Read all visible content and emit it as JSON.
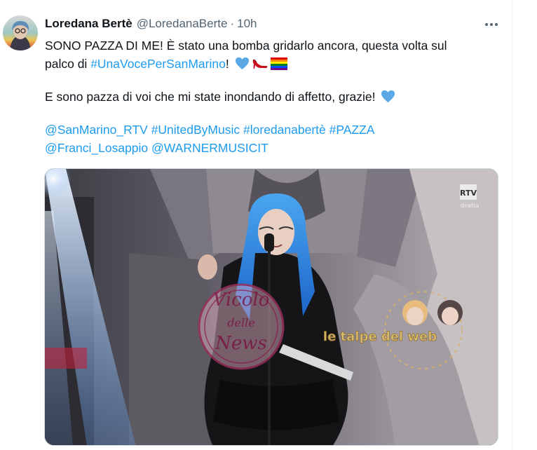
{
  "tweet": {
    "author_name": "Loredana Bertè",
    "handle": "@LoredanaBerte",
    "separator": "·",
    "time": "10h",
    "line1": "SONO PAZZA DI ME! È stato una bomba gridarlo ancora, questa volta sul",
    "line2_prefix": "palco di ",
    "line2_hashtag": "#UnaVocePerSanMarino",
    "line2_suffix": "!",
    "line3": "E sono pazza di voi che mi state inondando di affetto, grazie!",
    "mentions_line1": [
      "@SanMarino_RTV",
      "#UnitedByMusic",
      "#loredanabertè",
      "#PAZZA"
    ],
    "mentions_line2": [
      "@Franci_Losappio",
      "@WARNERMUSICIT"
    ]
  },
  "media": {
    "broadcaster_badge": "diretta",
    "watermark_1_lines": [
      "Vicolo",
      "delle",
      "News"
    ],
    "watermark_2": "le talpe del web"
  },
  "icons": {
    "more": "more-horizontal-icon",
    "heart": "blue-heart-icon",
    "heel": "high-heel-icon",
    "flag": "rainbow-flag-icon"
  },
  "colors": {
    "link": "#1d9bf0",
    "secondary_text": "#536471",
    "heart": "#5aa9e6"
  }
}
